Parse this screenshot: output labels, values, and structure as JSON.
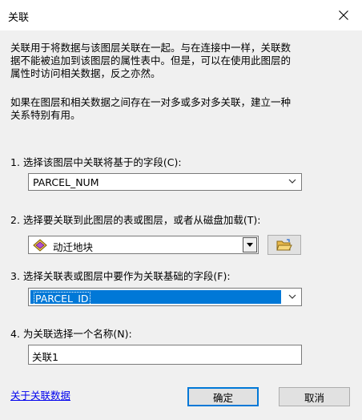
{
  "window": {
    "title": "关联",
    "close_icon": "close-icon"
  },
  "description": {
    "para1": "关联用于将数据与该图层关联在一起。与在连接中一样，关联数\n据不能被追加到该图层的属性表中。但是，可以在使用此图层的\n属性时访问相关数据，反之亦然。",
    "para2": "如果在图层和相关数据之间存在一对多或多对多关联，建立一种\n关系特别有用。"
  },
  "step1": {
    "label": "1. 选择该图层中关联将基于的字段(C):",
    "value": "PARCEL_NUM"
  },
  "step2": {
    "label": "2. 选择要关联到此图层的表或图层，或者从磁盘加载(T):",
    "value": "动迁地块",
    "icon": "layer-diamond-icon",
    "browse_icon": "open-folder-icon"
  },
  "step3": {
    "label": "3. 选择关联表或图层中要作为关联基础的字段(F):",
    "value": "PARCEL_ID"
  },
  "step4": {
    "label": "4. 为关联选择一个名称(N):",
    "value": "关联1"
  },
  "footer": {
    "link": "关于关联数据",
    "ok": "确定",
    "cancel": "取消"
  },
  "colors": {
    "accent": "#0078d7",
    "link": "#0000ee",
    "background": "#f0f0f0"
  }
}
